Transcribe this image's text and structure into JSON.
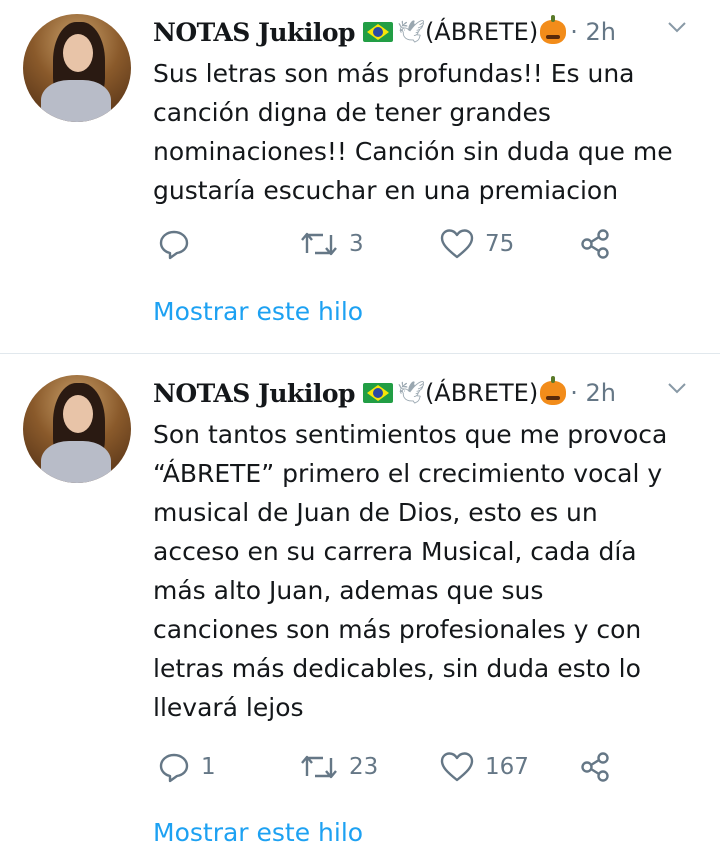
{
  "tweets": [
    {
      "author_name": "NOTAS Jukilop",
      "author_suffix": "(ÁBRETE)",
      "time": "· 2h",
      "text": "Sus letras son más profundas!! Es una\ncanción digna de tener grandes\nnominaciones!! Canción sin duda que me\ngustaría escuchar en una premiacion",
      "replies": "",
      "retweets": "3",
      "likes": "75",
      "thread_link": "Mostrar este hilo"
    },
    {
      "author_name": "NOTAS Jukilop",
      "author_suffix": "(ÁBRETE)",
      "time": "· 2h",
      "text": "Son tantos sentimientos que me provoca\n“ÁBRETE” primero el crecimiento vocal y\nmusical de Juan de Dios, esto es un\nacceso en su carrera Musical, cada día\nmás alto Juan, ademas que sus\ncanciones son más profesionales y con\nletras más dedicables, sin duda esto lo\nllevará lejos",
      "replies": "1",
      "retweets": "23",
      "likes": "167",
      "thread_link": "Mostrar este hilo"
    }
  ],
  "icons": {
    "flag": "brazil-flag-icon",
    "dove": "dove-icon",
    "pumpkin": "pumpkin-icon",
    "menu": "chevron-down-icon",
    "reply": "reply-icon",
    "retweet": "retweet-icon",
    "like": "heart-icon",
    "share": "share-icon"
  },
  "colors": {
    "link": "#1da1f2",
    "secondary": "#657786",
    "text": "#14171a",
    "divider": "#e1e8ed"
  }
}
